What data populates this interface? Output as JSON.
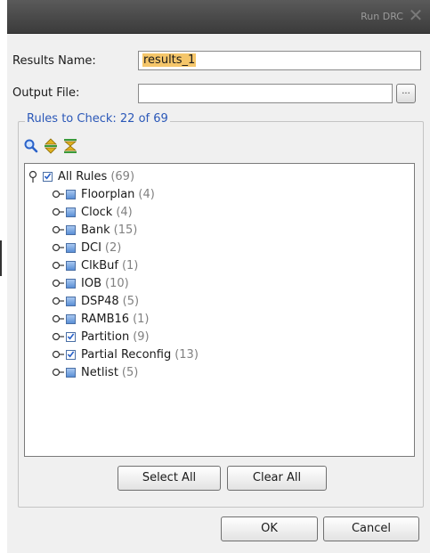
{
  "window": {
    "title": "Run DRC",
    "close_glyph": "✕"
  },
  "form": {
    "results_name_label": "Results Name:",
    "results_name_value": "results_1",
    "output_file_label": "Output File:",
    "output_file_value": "",
    "browse_label": "..."
  },
  "rules": {
    "group_label": "Rules to Check: 22 of 69",
    "toolbar_icons": [
      "search-icon",
      "expand-all-icon",
      "collapse-all-icon"
    ],
    "root": {
      "label": "All Rules",
      "count": "(69)",
      "state": "checked"
    },
    "items": [
      {
        "label": "Floorplan",
        "count": "(4)",
        "state": "partial"
      },
      {
        "label": "Clock",
        "count": "(4)",
        "state": "partial"
      },
      {
        "label": "Bank",
        "count": "(15)",
        "state": "partial"
      },
      {
        "label": "DCI",
        "count": "(2)",
        "state": "partial"
      },
      {
        "label": "ClkBuf",
        "count": "(1)",
        "state": "partial"
      },
      {
        "label": "IOB",
        "count": "(10)",
        "state": "partial"
      },
      {
        "label": "DSP48",
        "count": "(5)",
        "state": "partial"
      },
      {
        "label": "RAMB16",
        "count": "(1)",
        "state": "partial"
      },
      {
        "label": "Partition",
        "count": "(9)",
        "state": "checked"
      },
      {
        "label": "Partial Reconfig",
        "count": "(13)",
        "state": "checked"
      },
      {
        "label": "Netlist",
        "count": "(5)",
        "state": "partial"
      }
    ],
    "select_all_label": "Select All",
    "clear_all_label": "Clear All"
  },
  "footer": {
    "ok_label": "OK",
    "cancel_label": "Cancel"
  },
  "colors": {
    "title_bar": "#4a4a4a",
    "group_label": "#2b58b8",
    "highlight": "#f5c66a",
    "checkbox_blue": "#5a8fd6"
  }
}
